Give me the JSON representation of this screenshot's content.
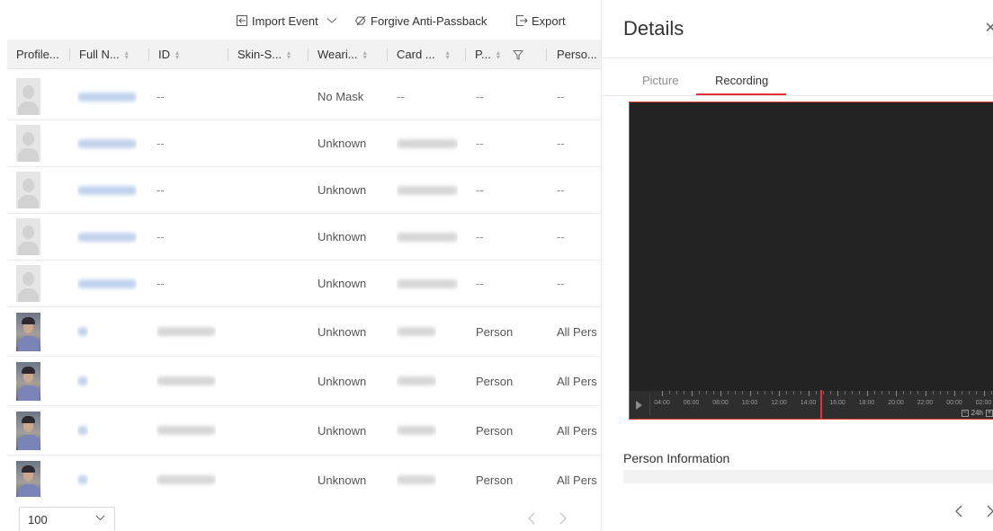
{
  "toolbar": {
    "import_event": "Import Event",
    "forgive": "Forgive Anti-Passback",
    "export": "Export"
  },
  "table": {
    "columns": [
      "Profile...",
      "Full N...",
      "ID",
      "Skin-S...",
      "Weari...",
      "Card ...",
      "P...",
      "Perso..."
    ],
    "rows": [
      {
        "photo": "placeholder",
        "id": "--",
        "wearing": "No Mask",
        "card": "--",
        "p": "--",
        "person": "--"
      },
      {
        "photo": "placeholder",
        "id": "--",
        "wearing": "Unknown",
        "card": "",
        "p": "--",
        "person": "--"
      },
      {
        "photo": "placeholder",
        "id": "--",
        "wearing": "Unknown",
        "card": "",
        "p": "--",
        "person": "--"
      },
      {
        "photo": "placeholder",
        "id": "--",
        "wearing": "Unknown",
        "card": "",
        "p": "--",
        "person": "--"
      },
      {
        "photo": "placeholder",
        "id": "--",
        "wearing": "Unknown",
        "card": "",
        "p": "--",
        "person": "--"
      },
      {
        "photo": "face",
        "id": "",
        "wearing": "Unknown",
        "card": "",
        "p": "Person",
        "person": "All Pers"
      },
      {
        "photo": "face",
        "id": "",
        "wearing": "Unknown",
        "card": "",
        "p": "Person",
        "person": "All Pers"
      },
      {
        "photo": "face",
        "id": "",
        "wearing": "Unknown",
        "card": "",
        "p": "Person",
        "person": "All Pers"
      },
      {
        "photo": "face",
        "id": "",
        "wearing": "Unknown",
        "card": "",
        "p": "Person",
        "person": "All Pers"
      }
    ]
  },
  "footer": {
    "page_size": "100"
  },
  "details": {
    "title": "Details",
    "tabs": [
      "Picture",
      "Recording"
    ],
    "active_tab": "Recording",
    "timeline_labels": [
      "04:00",
      "06:00",
      "08:00",
      "10:00",
      "12:00",
      "14:00",
      "16:00",
      "18:00",
      "20:00",
      "22:00",
      "00:00",
      "02:00"
    ],
    "zoom_label": "24h",
    "person_info_title": "Person Information"
  },
  "colors": {
    "accent": "#e8303b",
    "video_bg": "#232323",
    "header_bg": "#f2f2f2"
  }
}
